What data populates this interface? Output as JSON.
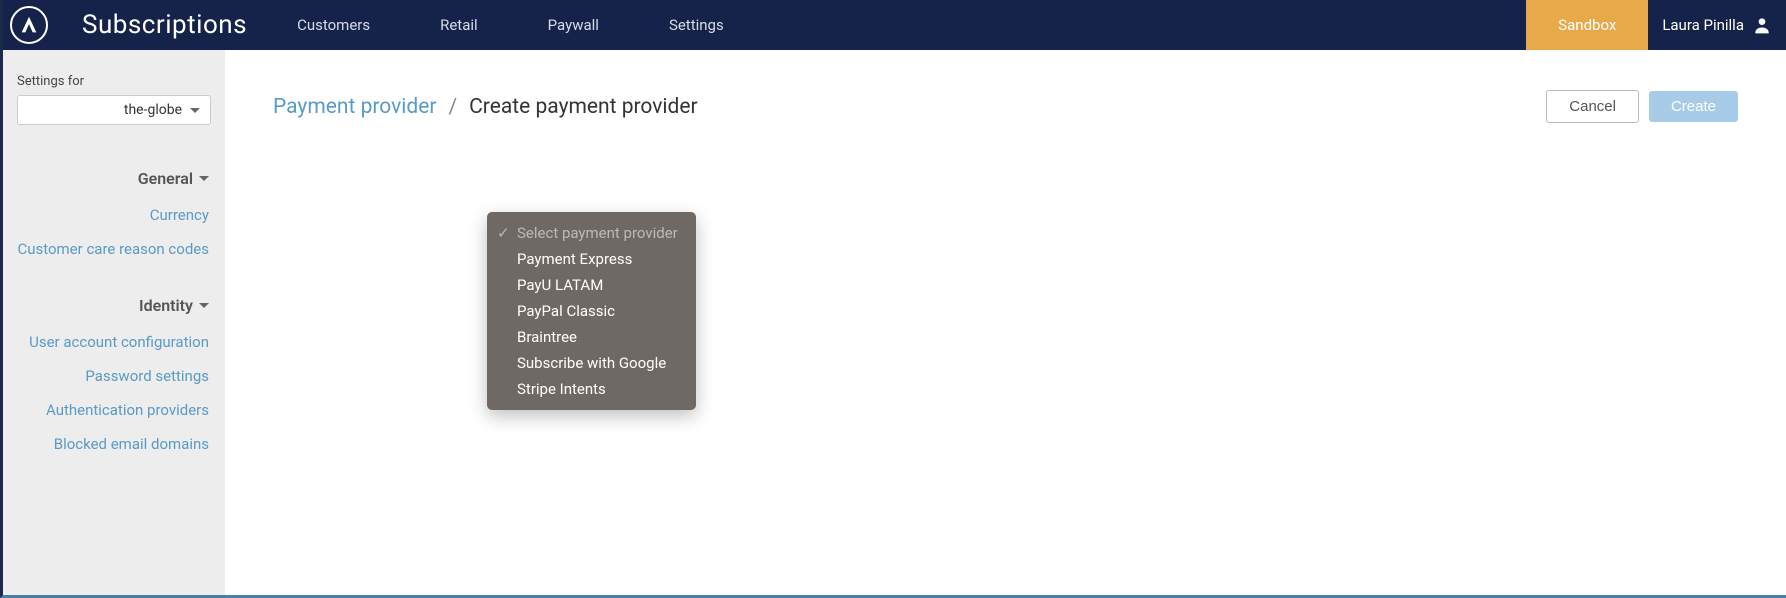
{
  "header": {
    "app_title": "Subscriptions",
    "nav": [
      "Customers",
      "Retail",
      "Paywall",
      "Settings"
    ],
    "sandbox": "Sandbox",
    "user": "Laura Pinilla"
  },
  "sidebar": {
    "settings_for_label": "Settings for",
    "site": "the-globe",
    "sections": [
      {
        "title": "General",
        "links": [
          "Currency",
          "Customer care reason codes"
        ]
      },
      {
        "title": "Identity",
        "links": [
          "User account configuration",
          "Password settings",
          "Authentication providers",
          "Blocked email domains"
        ]
      }
    ]
  },
  "breadcrumb": {
    "parent": "Payment provider",
    "sep": "/",
    "current": "Create payment provider"
  },
  "buttons": {
    "cancel": "Cancel",
    "create": "Create"
  },
  "dropdown": {
    "placeholder": "Select payment provider",
    "options": [
      "Payment Express",
      "PayU LATAM",
      "PayPal Classic",
      "Braintree",
      "Subscribe with Google",
      "Stripe Intents"
    ]
  }
}
